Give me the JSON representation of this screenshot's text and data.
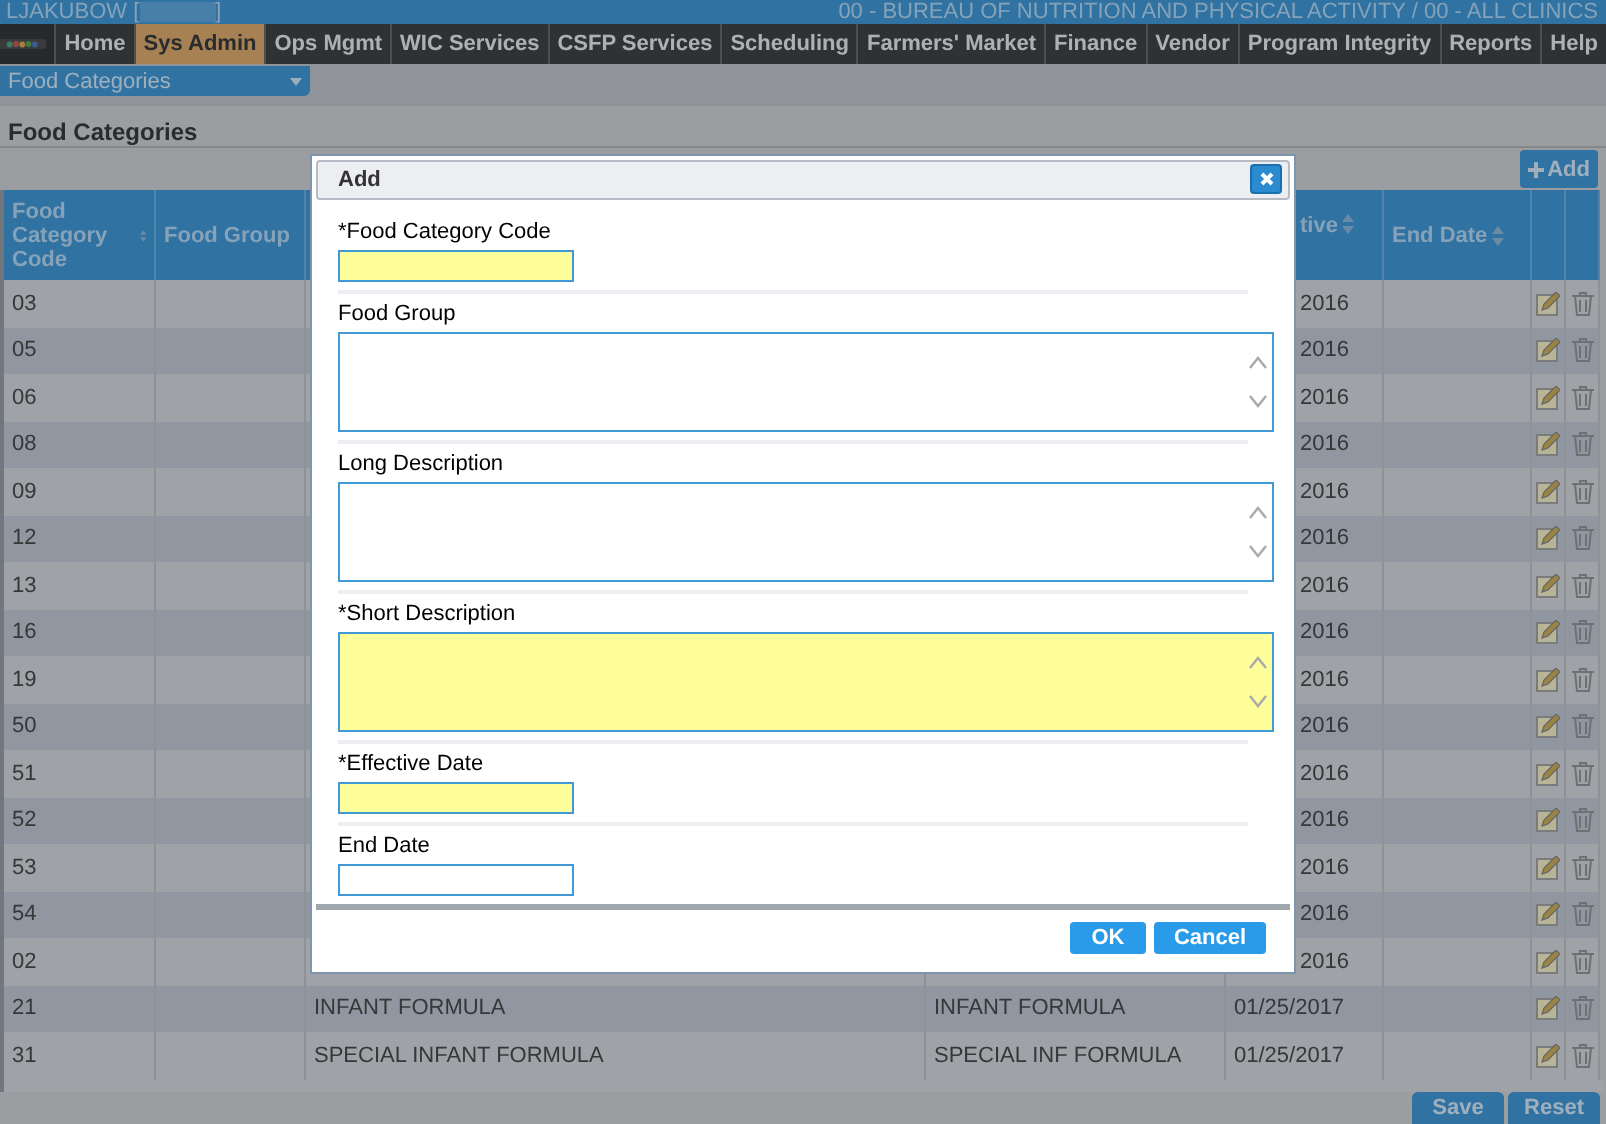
{
  "header": {
    "user": "LJAKUBOW [",
    "user_end": "]",
    "agency": "00 - BUREAU OF NUTRITION AND PHYSICAL ACTIVITY / 00 - ALL CLINICS"
  },
  "nav": {
    "tabs": [
      {
        "label": "Home",
        "selected": false
      },
      {
        "label": "Sys Admin",
        "selected": true
      },
      {
        "label": "Ops Mgmt",
        "selected": false
      },
      {
        "label": "WIC Services",
        "selected": false
      },
      {
        "label": "CSFP Services",
        "selected": false
      },
      {
        "label": "Scheduling",
        "selected": false
      },
      {
        "label": "Farmers' Market",
        "selected": false
      },
      {
        "label": "Finance",
        "selected": false
      },
      {
        "label": "Vendor",
        "selected": false
      },
      {
        "label": "Program Integrity",
        "selected": false
      },
      {
        "label": "Reports",
        "selected": false
      },
      {
        "label": "Help",
        "selected": false
      }
    ]
  },
  "subnav": {
    "dropdown": "Food Categories"
  },
  "page_title": "Food Categories",
  "toolbar": {
    "add_button": "Add"
  },
  "table": {
    "columns": [
      {
        "label": "Food Category Code",
        "sortable": true
      },
      {
        "label": "Food Group",
        "sortable": false
      },
      {},
      {},
      {
        "label": "tive",
        "sortable": true
      },
      {
        "label": "End Date",
        "sortable": true
      },
      {},
      {}
    ],
    "rows": [
      {
        "code": "03",
        "effective_date": "2016"
      },
      {
        "code": "05",
        "effective_date": "2016"
      },
      {
        "code": "06",
        "effective_date": "2016"
      },
      {
        "code": "08",
        "effective_date": "2016"
      },
      {
        "code": "09",
        "effective_date": "2016"
      },
      {
        "code": "12",
        "effective_date": "2016"
      },
      {
        "code": "13",
        "effective_date": "2016"
      },
      {
        "code": "16",
        "effective_date": "2016"
      },
      {
        "code": "19",
        "effective_date": "2016"
      },
      {
        "code": "50",
        "effective_date": "2016"
      },
      {
        "code": "51",
        "effective_date": "2016"
      },
      {
        "code": "52",
        "effective_date": "2016"
      },
      {
        "code": "53",
        "effective_date": "2016"
      },
      {
        "code": "54",
        "effective_date": "2016"
      },
      {
        "code": "02",
        "effective_date": "2016"
      },
      {
        "code": "21",
        "long_description": "INFANT FORMULA",
        "short_description": "INFANT FORMULA",
        "effective_date": "01/25/2017"
      },
      {
        "code": "31",
        "long_description": "SPECIAL INFANT FORMULA",
        "short_description": "SPECIAL INF FORMULA",
        "effective_date": "01/25/2017"
      }
    ]
  },
  "footer": {
    "buttons": [
      "Save",
      "Reset"
    ]
  },
  "dialog": {
    "title": "Add",
    "fields": [
      {
        "kind": "input",
        "label": "*Food Category Code",
        "required": true
      },
      {
        "kind": "textarea",
        "label": "Food Group",
        "required": false
      },
      {
        "kind": "textarea",
        "label": "Long Description",
        "required": false
      },
      {
        "kind": "textarea",
        "label": "*Short Description",
        "required": true
      },
      {
        "kind": "input",
        "label": "*Effective Date",
        "required": true
      },
      {
        "kind": "input",
        "label": "End Date",
        "required": false
      }
    ],
    "buttons": [
      "OK",
      "Cancel"
    ]
  }
}
